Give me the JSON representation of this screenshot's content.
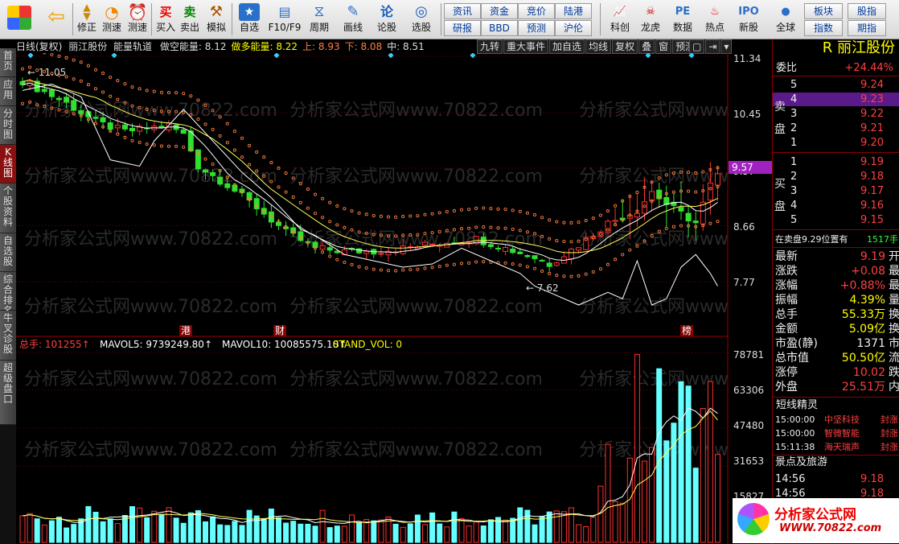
{
  "toolbar": {
    "buttons": [
      {
        "label": "",
        "icon": "windows-logo-icon"
      },
      {
        "label": "",
        "icon": "back-arrow-icon"
      },
      {
        "label": "修正",
        "icon": "up-down-icon"
      },
      {
        "label": "测速",
        "icon": "speed-icon"
      },
      {
        "label": "测速",
        "icon": "clock-icon"
      },
      {
        "label": "买入",
        "icon": "buy-icon"
      },
      {
        "label": "卖出",
        "icon": "sell-icon"
      },
      {
        "label": "模拟",
        "icon": "hammer-icon"
      },
      {
        "label": "自选",
        "icon": "star-icon"
      },
      {
        "label": "F10/F9",
        "icon": "f10-icon"
      },
      {
        "label": "周期",
        "icon": "period-icon"
      },
      {
        "label": "画线",
        "icon": "pencil-icon"
      },
      {
        "label": "论股",
        "icon": "discuss-icon"
      },
      {
        "label": "选股",
        "icon": "select-icon"
      }
    ],
    "buy_icon_text": "买",
    "sell_icon_text": "卖",
    "discuss_icon_text": "论",
    "grid_buttons": [
      "资讯",
      "资金",
      "竞价",
      "陆港",
      "研报",
      "BBD",
      "预测",
      "沪伦"
    ],
    "right_buttons": [
      {
        "label": "科创",
        "icon": "chart-icon"
      },
      {
        "label": "龙虎",
        "icon": "dragon-icon"
      },
      {
        "label": "数据",
        "icon": "pe-icon"
      },
      {
        "label": "热点",
        "icon": "hot-icon"
      },
      {
        "label": "新股",
        "icon": "ipo-icon"
      },
      {
        "label": "全球",
        "icon": "globe-icon"
      }
    ],
    "right_grid": [
      "板块",
      "股指",
      "指数",
      "期指"
    ]
  },
  "sidebar": {
    "tabs": [
      "首页",
      "应用",
      "分时图",
      "K线图",
      "个股资料",
      "自选股",
      "综合排名",
      "牛叉诊股",
      "超级盘口"
    ],
    "active": "K线图"
  },
  "info_bar": {
    "mode": "日线(复权)",
    "name": "丽江股份",
    "indicator": "能量轨道",
    "items": [
      {
        "text": "做空能量: 8.12",
        "color": "#ddd"
      },
      {
        "text": "做多能量: 8.22",
        "color": "#ffff00"
      },
      {
        "text": "上: 8.93",
        "color": "#ff8040"
      },
      {
        "text": "下: 8.08",
        "color": "#ff8040"
      },
      {
        "text": "中: 8.51",
        "color": "#ddd"
      }
    ]
  },
  "chart_tools": [
    "九转",
    "重大事件",
    "加自选",
    "均线",
    "复权",
    "叠",
    "窗",
    "预测"
  ],
  "price_axis": [
    "11.34",
    "10.45",
    "9.57",
    "8.66",
    "7.77"
  ],
  "current_price_label": "9.57",
  "annotations": {
    "high": "11.05",
    "low": "7.62",
    "events": [
      "港",
      "财",
      "榜"
    ]
  },
  "volume_bar": {
    "items": [
      {
        "text": "总手: 101255↑",
        "color": "#ff4040"
      },
      {
        "text": "MAVOL5: 9739249.80↑",
        "color": "#ffffff"
      },
      {
        "text": "MAVOL10: 10085575.10↑",
        "color": "#ffffff"
      },
      {
        "text": "STAND_VOL: 0",
        "color": "#ffff00"
      }
    ]
  },
  "volume_axis": [
    "78781",
    "63306",
    "47480",
    "31653",
    "15827"
  ],
  "watermark": "分析家公式网www.70822.com",
  "panel": {
    "header": "丽江股份",
    "ratio_label": "委比",
    "ratio": "+24.44%",
    "sell_label": "卖盘",
    "buy_label": "买盘",
    "sells": [
      {
        "lvl": "5",
        "price": "9.24"
      },
      {
        "lvl": "4",
        "price": "9.23"
      },
      {
        "lvl": "3",
        "price": "9.22"
      },
      {
        "lvl": "2",
        "price": "9.21"
      },
      {
        "lvl": "1",
        "price": "9.20"
      }
    ],
    "buys": [
      {
        "lvl": "1",
        "price": "9.19"
      },
      {
        "lvl": "2",
        "price": "9.18"
      },
      {
        "lvl": "3",
        "price": "9.17"
      },
      {
        "lvl": "4",
        "price": "9.16"
      },
      {
        "lvl": "5",
        "price": "9.15"
      }
    ],
    "notice": "在卖盘9.29位置有",
    "notice_count": "1517手",
    "stats": [
      {
        "k": "最新",
        "v": "9.19",
        "c": "#ff4040",
        "t": "开"
      },
      {
        "k": "涨跌",
        "v": "+0.08",
        "c": "#ff4040",
        "t": "最"
      },
      {
        "k": "涨幅",
        "v": "+0.88%",
        "c": "#ff4040",
        "t": "最"
      },
      {
        "k": "振幅",
        "v": "4.39%",
        "c": "#ffff00",
        "t": "量"
      },
      {
        "k": "总手",
        "v": "55.33万",
        "c": "#ffff00",
        "t": "换"
      },
      {
        "k": "金额",
        "v": "5.09亿",
        "c": "#ffff00",
        "t": "换"
      },
      {
        "k": "市盈(静)",
        "v": "1371",
        "c": "#eeeeee",
        "t": "市"
      },
      {
        "k": "总市值",
        "v": "50.50亿",
        "c": "#ffff00",
        "t": "流"
      },
      {
        "k": "涨停",
        "v": "10.02",
        "c": "#ff4040",
        "t": "跌"
      },
      {
        "k": "外盘",
        "v": "25.51万",
        "c": "#ff4040",
        "t": "内"
      }
    ],
    "short_title": "短线精灵",
    "shorts": [
      {
        "time": "15:00:00",
        "name": "中坚科技",
        "act": "封涨"
      },
      {
        "time": "15:00:00",
        "name": "智微智能",
        "act": "封涨"
      },
      {
        "time": "15:11:38",
        "name": "海天瑞声",
        "act": "封涨"
      }
    ],
    "sector": "景点及旅游",
    "ticks": [
      {
        "time": "14:56",
        "price": "9.18"
      },
      {
        "time": "14:56",
        "price": "9.18"
      }
    ],
    "logo": "分析家公式网",
    "logo_url": "WWW.70822.com"
  }
}
